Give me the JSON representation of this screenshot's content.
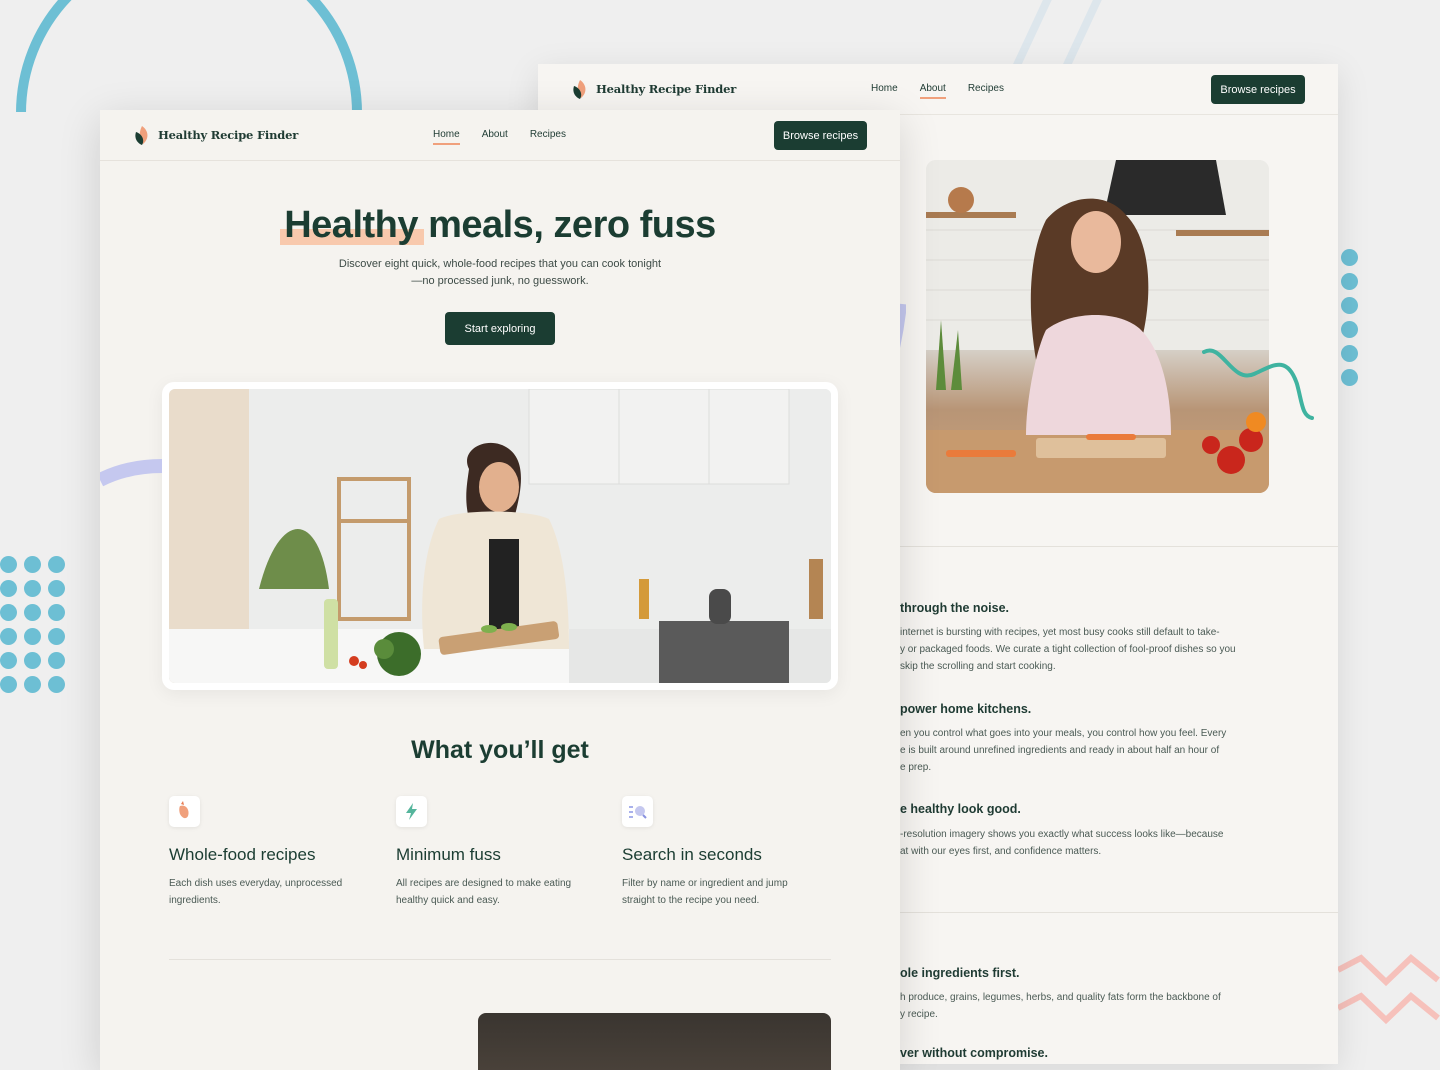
{
  "brand": {
    "name": "Healthy Recipe Finder"
  },
  "back_page": {
    "nav": [
      "Home",
      "About",
      "Recipes"
    ],
    "active_nav": "About",
    "cta": "Browse recipes",
    "sections": [
      {
        "heading": "through the noise.",
        "body": "internet is bursting with recipes, yet most busy cooks still default to take-\ny or packaged foods. We curate a tight collection of fool-proof dishes so you\nskip the scrolling and start cooking."
      },
      {
        "heading": "power home kitchens.",
        "body": "en you control what goes into your meals, you control how you feel. Every\ne is built around unrefined ingredients and ready in about half an hour of\ne prep."
      },
      {
        "heading": "e healthy look good.",
        "body": "-resolution imagery shows you exactly what success looks like—because\nat with our eyes first, and confidence matters."
      },
      {
        "heading": "ole ingredients first.",
        "body": "h produce, grains, legumes, herbs, and quality fats form the backbone of\ny recipe."
      },
      {
        "heading": "ver without compromise.",
        "body": ""
      }
    ]
  },
  "front_page": {
    "nav": [
      "Home",
      "About",
      "Recipes"
    ],
    "active_nav": "Home",
    "cta": "Browse recipes",
    "hero": {
      "title_highlight": "Healthy",
      "title_rest": " meals, zero fuss",
      "subtitle_line1": "Discover eight quick, whole-food recipes that you can cook tonight",
      "subtitle_line2": "—no processed junk, no guesswork.",
      "button": "Start exploring"
    },
    "features_title": "What you’ll get",
    "features": [
      {
        "icon": "carrot-icon",
        "title": "Whole-food recipes",
        "desc": "Each dish uses everyday, unprocessed ingredients."
      },
      {
        "icon": "lightning-icon",
        "title": "Minimum fuss",
        "desc": "All recipes are designed to make eating healthy quick and easy."
      },
      {
        "icon": "search-list-icon",
        "title": "Search in seconds",
        "desc": "Filter by name or ingredient and jump straight to the recipe you need."
      }
    ]
  },
  "colors": {
    "primary": "#1b3d32",
    "accent": "#f0a07c",
    "highlight": "#f8c9ad",
    "teal": "#6dbfd4",
    "lavender": "#c5c8ef"
  }
}
